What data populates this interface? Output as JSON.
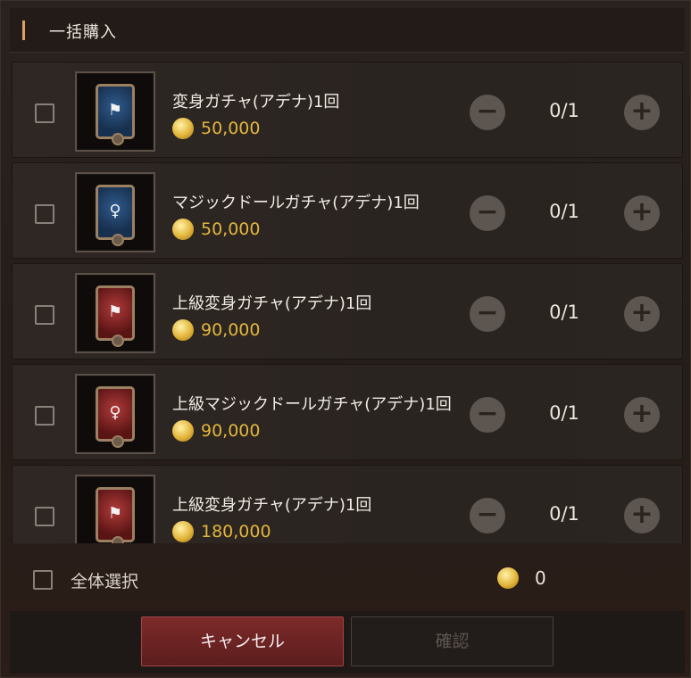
{
  "header": {
    "title": "一括購入"
  },
  "items": [
    {
      "name": "変身ガチャ(アデナ)1回",
      "price": "50,000",
      "qty": "0/1",
      "card_color": "blue",
      "card_icon": "transform-card-icon",
      "card_glyph": "⚑"
    },
    {
      "name": "マジックドールガチャ(アデナ)1回",
      "price": "50,000",
      "qty": "0/1",
      "card_color": "blue",
      "card_icon": "magic-doll-card-icon",
      "card_glyph": "♀"
    },
    {
      "name": "上級変身ガチャ(アデナ)1回",
      "price": "90,000",
      "qty": "0/1",
      "card_color": "red",
      "card_icon": "transform-card-icon",
      "card_glyph": "⚑"
    },
    {
      "name": "上級マジックドールガチャ(アデナ)1回",
      "price": "90,000",
      "qty": "0/1",
      "card_color": "red",
      "card_icon": "magic-doll-card-icon",
      "card_glyph": "♀"
    },
    {
      "name": "上級変身ガチャ(アデナ)1回",
      "price": "180,000",
      "qty": "0/1",
      "card_color": "red",
      "card_icon": "transform-card-icon",
      "card_glyph": "⚑"
    }
  ],
  "footer": {
    "select_all_label": "全体選択",
    "total": "0",
    "cancel_label": "キャンセル",
    "confirm_label": "確認"
  },
  "icons": {
    "minus": "minus-circle-icon",
    "plus": "plus-circle-icon",
    "currency": "adena-coin-icon"
  },
  "colors": {
    "price": "#e3b63d",
    "cancel_button": "#7d2a2a",
    "header_accent": "#e0a060"
  }
}
